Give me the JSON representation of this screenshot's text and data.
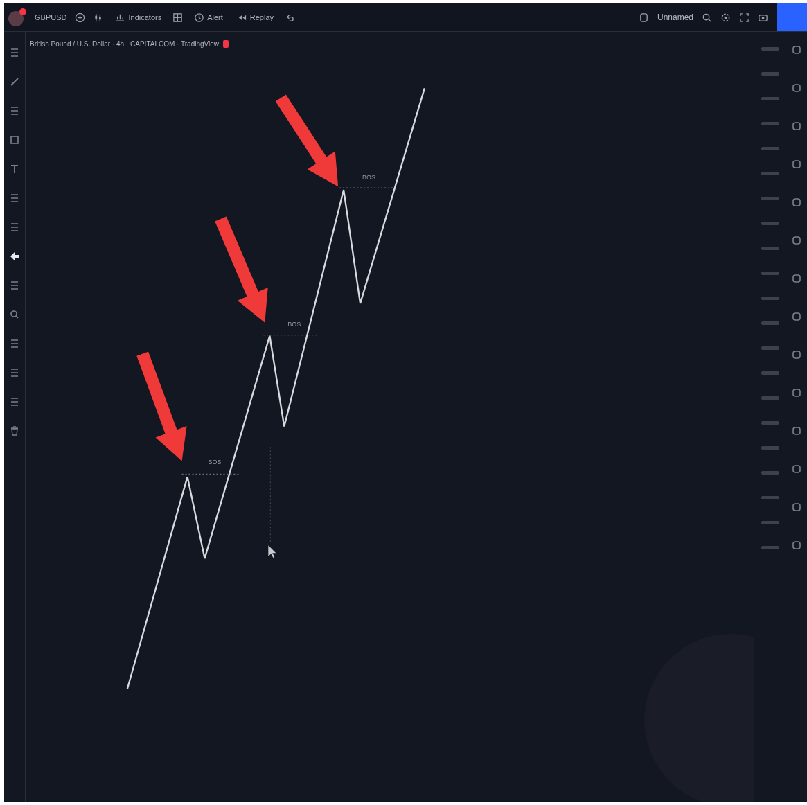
{
  "top_bar": {
    "symbol": "GBPUSD",
    "items": [
      {
        "kind": "indicators",
        "label": "Indicators"
      },
      {
        "kind": "alert",
        "label": "Alert"
      },
      {
        "kind": "replay",
        "label": "Replay"
      }
    ],
    "layout_name": "Unnamed"
  },
  "chart": {
    "title": "British Pound / U.S. Dollar · 4h · CAPITALCOM · TradingView",
    "breaks": [
      {
        "label": "BOS"
      },
      {
        "label": "BOS"
      },
      {
        "label": "BOS"
      }
    ]
  }
}
